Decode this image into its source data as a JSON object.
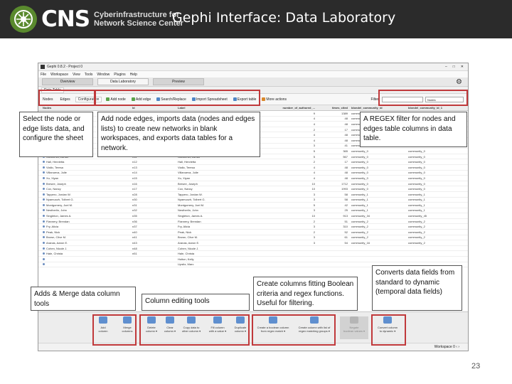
{
  "header": {
    "logo_letters": "CNS",
    "logo_sub_line1": "Cyberinfrastructure for",
    "logo_sub_line2": "Network Science Center",
    "title": "Gephi Interface: Data Laboratory"
  },
  "window": {
    "title": "Gephi 0.8.2 - Project 0",
    "controls": [
      "–",
      "□",
      "✕"
    ],
    "menu": [
      "File",
      "Workspace",
      "View",
      "Tools",
      "Window",
      "Plugins",
      "Help"
    ],
    "main_tabs": [
      "Overview",
      "Data Laboratory",
      "Preview"
    ],
    "panel_tab": "Data Table",
    "sub_tabs": [
      "Nodes",
      "Edges",
      "Configuration"
    ],
    "toolbar": [
      "Add node",
      "Add edge",
      "Search/Replace",
      "Import Spreadsheet",
      "Export table",
      "More actions"
    ],
    "filter_label": "Filter:",
    "filter_column": "Nodes",
    "columns": [
      "Nodes",
      "Id",
      "Label",
      "number_of_authored_...",
      "times_cited",
      "blondel_community_id",
      "blondel_community_id_1"
    ],
    "rows": [
      [
        "",
        "",
        "",
        "9",
        "1389",
        "community_0",
        ""
      ],
      [
        "",
        "",
        "",
        "4",
        "48",
        "community_0",
        ""
      ],
      [
        "",
        "",
        "",
        "4",
        "48",
        "community_0",
        ""
      ],
      [
        "",
        "",
        "",
        "2",
        "17",
        "community_0",
        ""
      ],
      [
        "",
        "",
        "",
        "4",
        "48",
        "community_0",
        ""
      ],
      [
        "",
        "",
        "",
        "4",
        "48",
        "community_0",
        ""
      ],
      [
        "",
        "",
        "",
        "3",
        "41",
        "community_0",
        ""
      ],
      [
        "Chavez, Sandra S.",
        "n10",
        "Chavez, Sandra S.",
        "5",
        "365",
        "community_0",
        "community_0"
      ],
      [
        "Gubareva, Larisa",
        "n11",
        "Gubareva, Larisa",
        "5",
        "567",
        "community_0",
        "community_0"
      ],
      [
        "Hall, Henrietta",
        "n12",
        "Hall, Henrietta",
        "2",
        "17",
        "community_0",
        "community_0"
      ],
      [
        "Viallo, Teresa",
        "n13",
        "Viallo, Teresa",
        "4",
        "48",
        "community_0",
        "community_0"
      ],
      [
        "Villanueva, Julie",
        "n14",
        "Villanueva, Julie",
        "4",
        "48",
        "community_0",
        "community_0"
      ],
      [
        "Xu, Xiyan",
        "n15",
        "Xu, Xiyan",
        "4",
        "48",
        "community_0",
        "community_0"
      ],
      [
        "Bresee, Joseph",
        "n16",
        "Bresee, Joseph",
        "10",
        "1712",
        "community_0",
        "community_0"
      ],
      [
        "Cox, Nancy",
        "n17",
        "Cox, Nancy",
        "10",
        "1993",
        "community_0",
        "community_0"
      ],
      [
        "Tappero, Jordan W.",
        "n28",
        "Tappero, Jordan W.",
        "3",
        "58",
        "community_1",
        "community_1"
      ],
      [
        "Nyamuozh, Tolbert G.",
        "n30",
        "Nyamuozh, Tolbert G.",
        "3",
        "58",
        "community_1",
        "community_1"
      ],
      [
        "Montgomery, Joel M.",
        "n31",
        "Montgomery, Joel M.",
        "5",
        "42",
        "community_1",
        "community_1"
      ],
      [
        "Nestherlin, John",
        "n32",
        "Nestherlin, John",
        "3",
        "25",
        "community_1",
        "community_1"
      ],
      [
        "Singleton, James A.",
        "n35",
        "Singleton, James A.",
        "10",
        "913",
        "community_34",
        "community_45"
      ],
      [
        "Flannery, Brendan",
        "n36",
        "Flannery, Brendan",
        "2",
        "51",
        "community_2",
        "community_2"
      ],
      [
        "Fry, Alicia",
        "n37",
        "Fry, Alicia",
        "3",
        "310",
        "community_2",
        "community_2"
      ],
      [
        "Peak, Nick",
        "n40",
        "Peak, Nick",
        "2",
        "52",
        "community_2",
        "community_2"
      ],
      [
        "Brown, Clive M.",
        "n41",
        "Brown, Clive M.",
        "3",
        "61",
        "community_2",
        "community_2"
      ],
      [
        "Aranas, Aaron E.",
        "n43",
        "Aranas, Aaron E.",
        "3",
        "54",
        "community_16",
        "community_2"
      ],
      [
        "Cohen, Nicole J.",
        "n48",
        "Cohen, Nicole J.",
        "",
        "",
        "",
        ""
      ],
      [
        "Hale, Christa",
        "n51",
        "Hale, Christa",
        "",
        "",
        "",
        ""
      ],
      [
        "",
        "",
        "Holton, Kelly",
        "",
        "",
        "",
        ""
      ],
      [
        "",
        "",
        "Lipsitz, Marc",
        "",
        "",
        "",
        ""
      ]
    ],
    "bottom_buttons": [
      {
        "label": "Add\ncolumn"
      },
      {
        "label": "Merge\ncolumns"
      },
      {
        "label": "Delete\ncolumn ▾"
      },
      {
        "label": "Clear\ncolumn ▾"
      },
      {
        "label": "Copy data to\nother column ▾"
      },
      {
        "label": "Fill column\nwith a value ▾"
      },
      {
        "label": "Duplicate\ncolumn ▾"
      },
      {
        "label": "Create a boolean column\nfrom regex match ▾"
      },
      {
        "label": "Create column with list of\nregex matching groups ▾"
      },
      {
        "label": "Negate\nboolean values ▾"
      },
      {
        "label": "Convert column\nto dynamic ▾"
      }
    ],
    "workspace": "Workspace 0  ‹  ›"
  },
  "callouts": {
    "select_sheet": "Select the node or edge lists data, and configure the sheet",
    "add_import_export": "Add node edges, imports data (nodes and edges lists) to create new networks in blank workspaces, and exports data tables for a network.",
    "regex_filter": "A REGEX filter for nodes and edges table columns in data table.",
    "adds_merge": "Adds & Merge data column tools",
    "column_editing": "Column editing tools",
    "create_columns": "Create columns fitting Boolean criteria and regex functions. Useful for filtering.",
    "convert_dynamic": "Converts data fields from standard to dynamic (temporal data fields)"
  },
  "page_number": "23",
  "colors": {
    "banner": "#2b2b2b",
    "logo_green": "#5a8a2e",
    "highlight_red": "#c0393b"
  }
}
